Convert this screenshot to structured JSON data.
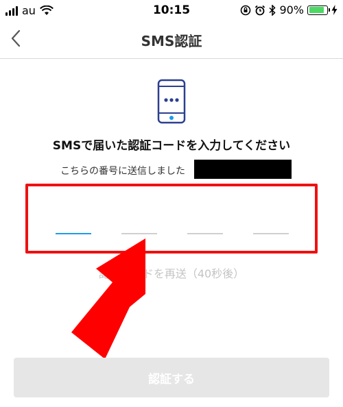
{
  "status_bar": {
    "carrier": "au",
    "time": "10:15",
    "battery_percent": "90%",
    "battery_level": 0.9,
    "icons": [
      "signal-icon",
      "wifi-icon",
      "orientation-lock-icon",
      "alarm-icon",
      "bluetooth-icon",
      "battery-icon",
      "charging-icon"
    ]
  },
  "nav": {
    "title": "SMS認証",
    "back_icon": "chevron-left-icon"
  },
  "main": {
    "icon": "phone-icon",
    "heading": "SMSで届いた認証コードを入力してください",
    "sub_text": "こちらの番号に送信しました",
    "resend_text": "認証コードを再送（40秒後）",
    "code_slot_count": 4,
    "submit_label": "認証する"
  },
  "colors": {
    "highlight": "#ee1111",
    "accent": "#1d9bea",
    "battery": "#4cd964",
    "arrow": "#ff0000"
  }
}
